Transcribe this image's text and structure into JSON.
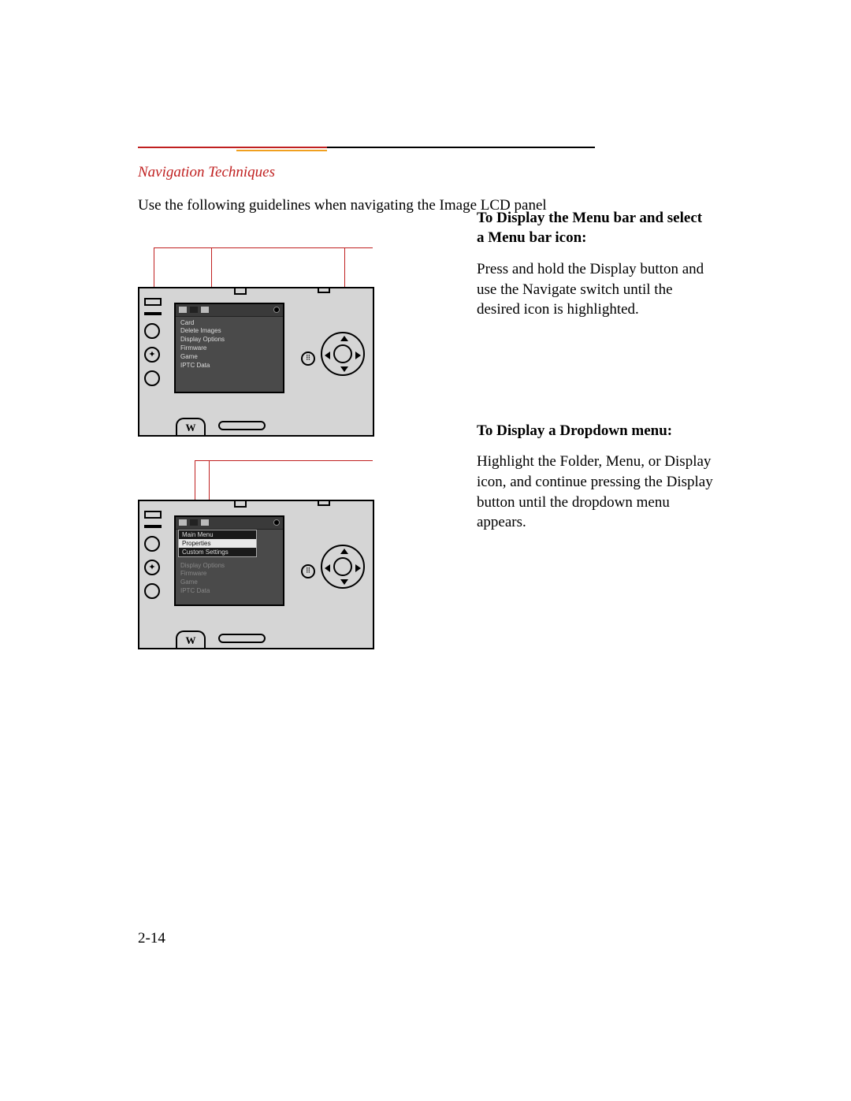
{
  "section_title": "Navigation Techniques",
  "intro": "Use the following guidelines when navigating the Image LCD panel",
  "page_number": "2-14",
  "block1": {
    "heading": "To Display the Menu bar and select a Menu bar icon:",
    "body": "Press and hold the Display button and use the Navigate switch until the desired icon is highlighted.",
    "lcd_menu": {
      "items": [
        "Card",
        "Delete Images",
        "Display Options",
        "Firmware",
        "Game",
        "IPTC Data"
      ]
    }
  },
  "block2": {
    "heading": "To Display a Dropdown menu:",
    "body": "Highlight the Folder, Menu, or Display icon, and continue pressing the Display button until the dropdown menu appears.",
    "lcd_dropdown": {
      "items": [
        "Main Menu",
        "Properties",
        "Custom Settings"
      ],
      "highlighted_index": 1
    },
    "lcd_below": [
      "Display Options",
      "Firmware",
      "Game",
      "IPTC Data"
    ]
  },
  "camera_labels": {
    "bottom_bump_glyph": "W",
    "diamond_glyph": "✦",
    "dots_glyph": "⠿"
  }
}
